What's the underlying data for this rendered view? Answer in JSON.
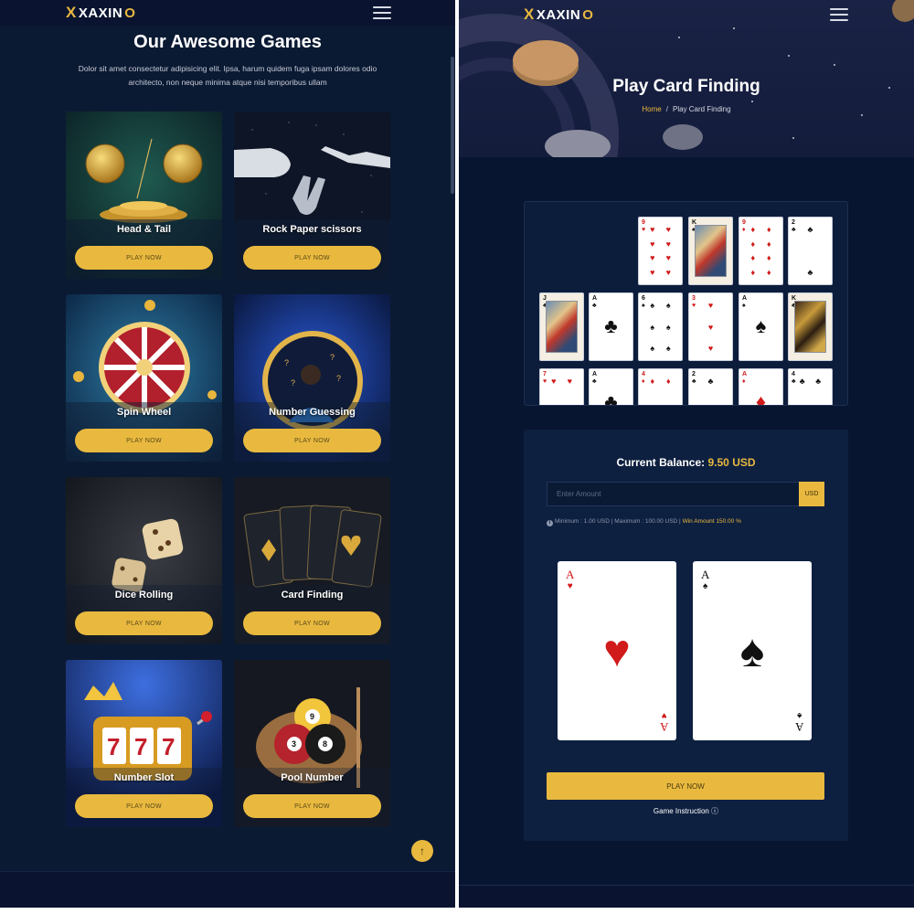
{
  "brand": {
    "logo_x": "X",
    "logo_text_a": "XAXIN",
    "logo_text_b": "O"
  },
  "left": {
    "section_title": "Our Awesome Games",
    "section_desc": "Dolor sit amet consectetur adipisicing elit. Ipsa, harum quidem fuga ipsam dolores odio architecto, non neque minima atque nisi temporibus ullam",
    "games": [
      {
        "name": "Head & Tail",
        "button": "PLAY NOW"
      },
      {
        "name": "Rock Paper scissors",
        "button": "PLAY NOW"
      },
      {
        "name": "Spin Wheel",
        "button": "PLAY NOW"
      },
      {
        "name": "Number Guessing",
        "button": "PLAY NOW"
      },
      {
        "name": "Dice Rolling",
        "button": "PLAY NOW"
      },
      {
        "name": "Card Finding",
        "button": "PLAY NOW"
      },
      {
        "name": "Number Slot",
        "button": "PLAY NOW"
      },
      {
        "name": "Pool Number",
        "button": "PLAY NOW"
      }
    ],
    "scroll_top_icon": "↑"
  },
  "right": {
    "page_title": "Play Card Finding",
    "breadcrumb": {
      "home": "Home",
      "separator": "/",
      "current": "Play Card Finding"
    },
    "balance_label": "Current Balance:",
    "balance_value": "9.50 USD",
    "amount_placeholder": "Enter Amount",
    "currency": "USD",
    "limits_text": "Minimum : 1.00 USD | Maximum : 100.00 USD | ",
    "win_text": "Win Amount 150.00 %",
    "choice_cards": [
      {
        "rank": "A",
        "suit": "♥",
        "color": "red"
      },
      {
        "rank": "A",
        "suit": "♠",
        "color": "black"
      }
    ],
    "play_button": "PLAY NOW",
    "instruction": "Game Instruction ⓘ"
  },
  "colors": {
    "accent": "#e9b93f",
    "bg_dark": "#081530",
    "panel": "#0e2040"
  }
}
